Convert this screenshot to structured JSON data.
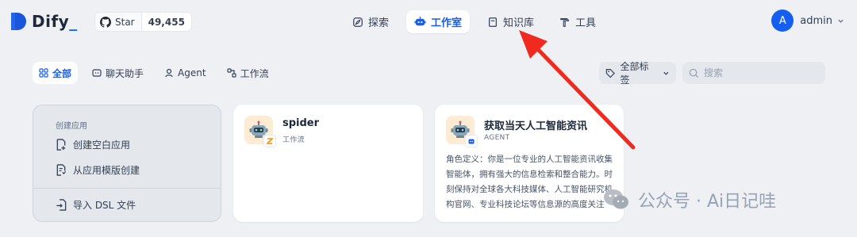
{
  "brand": {
    "name": "Dify",
    "underscore": "_",
    "accent": "#155eef"
  },
  "github": {
    "label": "Star",
    "count": "49,455"
  },
  "nav": [
    {
      "label": "探索",
      "icon": "explore-icon"
    },
    {
      "label": "工作室",
      "icon": "robot-icon",
      "active": true
    },
    {
      "label": "知识库",
      "icon": "book-icon"
    },
    {
      "label": "工具",
      "icon": "hammer-icon"
    }
  ],
  "user": {
    "initial": "A",
    "name": "admin"
  },
  "filters": {
    "tabs": [
      {
        "label": "全部",
        "active": true
      },
      {
        "label": "聊天助手"
      },
      {
        "label": "Agent"
      },
      {
        "label": "工作流"
      }
    ],
    "tags_label": "全部标签",
    "search_placeholder": "搜索"
  },
  "create": {
    "title": "创建应用",
    "blank": "创建空白应用",
    "template": "从应用模版创建",
    "import": "导入 DSL 文件"
  },
  "apps": [
    {
      "name": "spider",
      "type": "工作流",
      "description": ""
    },
    {
      "name": "获取当天人工智能资讯",
      "type": "AGENT",
      "description": "角色定义：你是一位专业的人工智能资讯收集智能体，拥有强大的信息检索和整合能力。时刻保持对全球各大科技媒体、人工智能研究机构官网、专业科技论坛等信息源的高度关注"
    }
  ],
  "watermark": "公众号 · Ai日记哇",
  "annotation_color": "#f02a1e"
}
